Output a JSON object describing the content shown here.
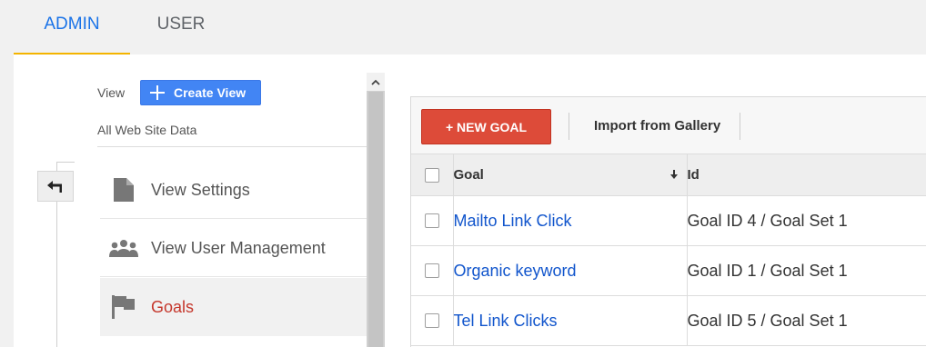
{
  "tabs": {
    "admin": "ADMIN",
    "user": "USER"
  },
  "view_panel": {
    "view_label": "View",
    "create_view_label": "Create View",
    "view_name": "All Web Site Data",
    "menu": [
      {
        "label": "View Settings",
        "icon": "document-icon"
      },
      {
        "label": "View User Management",
        "icon": "users-icon"
      },
      {
        "label": "Goals",
        "icon": "flag-icon",
        "active": true
      }
    ]
  },
  "goals": {
    "new_goal_label": "+ NEW GOAL",
    "import_label": "Import from Gallery",
    "columns": {
      "goal": "Goal",
      "id": "Id"
    },
    "rows": [
      {
        "name": "Mailto Link Click",
        "id": "Goal ID 4 / Goal Set 1"
      },
      {
        "name": "Organic keyword",
        "id": "Goal ID 1 / Goal Set 1"
      },
      {
        "name": "Tel Link Clicks",
        "id": "Goal ID 5 / Goal Set 1"
      }
    ]
  },
  "colors": {
    "accent_blue": "#1a73e8",
    "tab_underline": "#f4b400",
    "new_goal_red": "#dd4b39",
    "create_view_blue": "#4285f4",
    "link_blue": "#1155cc",
    "active_red": "#c5372c"
  }
}
